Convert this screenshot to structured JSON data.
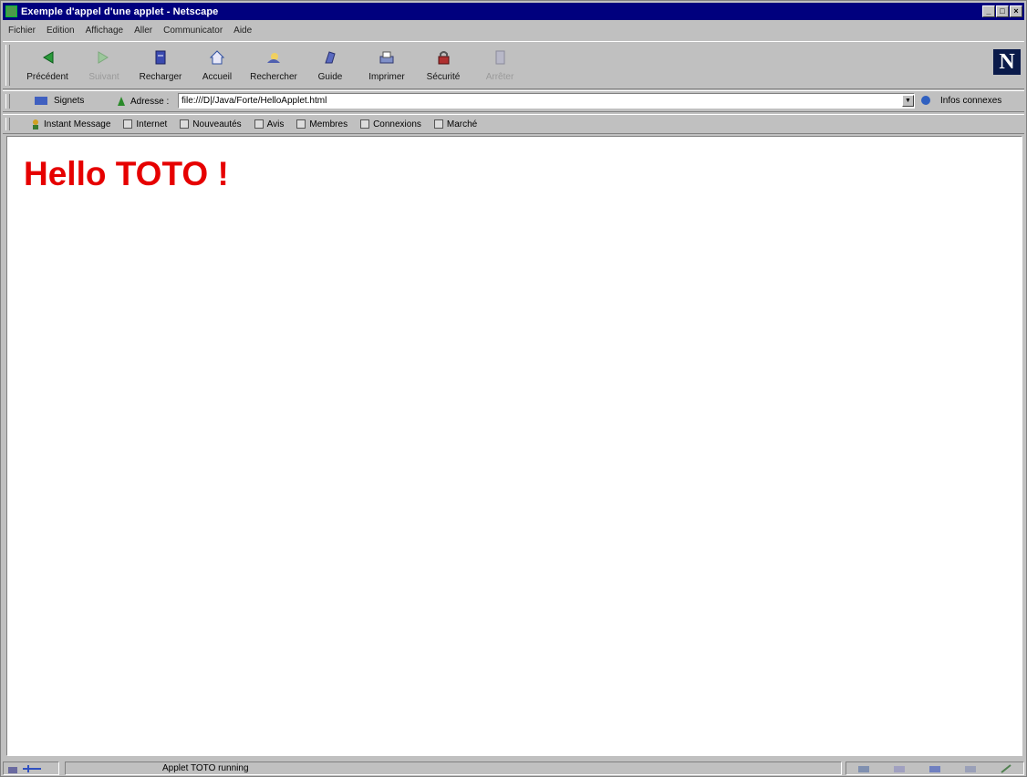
{
  "window": {
    "title": "Exemple d'appel d'une applet - Netscape"
  },
  "menu": [
    "Fichier",
    "Edition",
    "Affichage",
    "Aller",
    "Communicator",
    "Aide"
  ],
  "nav": [
    {
      "label": "Précédent",
      "icon": "back-arrow-icon",
      "enabled": true
    },
    {
      "label": "Suivant",
      "icon": "forward-arrow-icon",
      "enabled": false
    },
    {
      "label": "Recharger",
      "icon": "reload-icon",
      "enabled": true
    },
    {
      "label": "Accueil",
      "icon": "home-icon",
      "enabled": true
    },
    {
      "label": "Rechercher",
      "icon": "search-icon",
      "enabled": true
    },
    {
      "label": "Guide",
      "icon": "guide-icon",
      "enabled": true
    },
    {
      "label": "Imprimer",
      "icon": "print-icon",
      "enabled": true
    },
    {
      "label": "Sécurité",
      "icon": "security-lock-icon",
      "enabled": true
    },
    {
      "label": "Arrêter",
      "icon": "stop-icon",
      "enabled": false
    }
  ],
  "location": {
    "bookmarks_label": "Signets",
    "address_label": "Adresse :",
    "url": "file:///D|/Java/Forte/HelloApplet.html",
    "related_label": "Infos connexes"
  },
  "personal": [
    "Instant Message",
    "Internet",
    "Nouveautés",
    "Avis",
    "Membres",
    "Connexions",
    "Marché"
  ],
  "page": {
    "heading": "Hello TOTO !"
  },
  "status": {
    "text": "Applet TOTO running"
  },
  "colors": {
    "titlebar": "#00007e",
    "heading": "#e60000",
    "chrome": "#c0c0c0"
  }
}
